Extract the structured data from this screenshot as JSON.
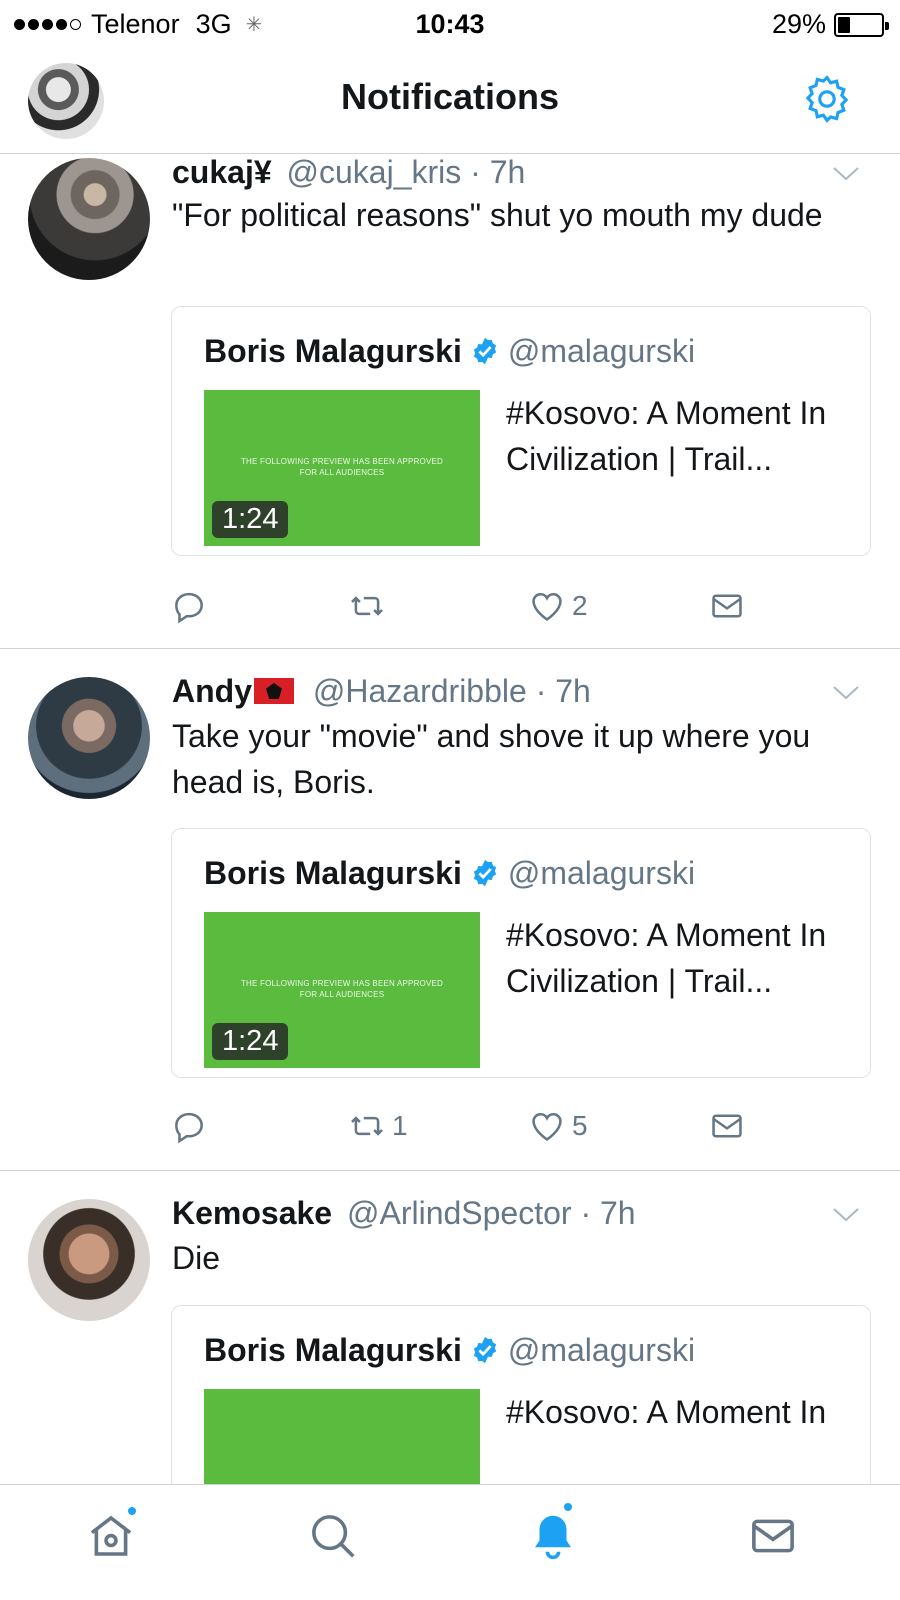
{
  "status_bar": {
    "carrier": "Telenor",
    "network": "3G",
    "time": "10:43",
    "battery": "29%",
    "battery_level": 0.29
  },
  "nav": {
    "title": "Notifications",
    "accent_color": "#1da1f2"
  },
  "tweets": [
    {
      "name": "cukaj¥",
      "handle": "@cukaj_kris",
      "time": "· 7h",
      "text": "\"For political reasons\" shut yo mouth my dude",
      "quoted": {
        "name": "Boris Malagurski",
        "handle": "@malagurski",
        "title": "#Kosovo: A Moment In Civilization | Trail...",
        "duration": "1:24",
        "thumb_text": "THE FOLLOWING PREVIEW HAS BEEN APPROVED FOR ALL AUDIENCES"
      },
      "retweets": "",
      "likes": "2"
    },
    {
      "name": "Andy",
      "flag": "🇦🇱",
      "handle": "@Hazardribble",
      "time": "· 7h",
      "text": "Take your \"movie\" and shove it up where you head is, Boris.",
      "quoted": {
        "name": "Boris Malagurski",
        "handle": "@malagurski",
        "title": "#Kosovo: A Moment In Civilization | Trail...",
        "duration": "1:24",
        "thumb_text": "THE FOLLOWING PREVIEW HAS BEEN APPROVED FOR ALL AUDIENCES"
      },
      "retweets": "1",
      "likes": "5"
    },
    {
      "name": "Kemosake",
      "handle": "@ArlindSpector",
      "time": "· 7h",
      "text": "Die",
      "quoted": {
        "name": "Boris Malagurski",
        "handle": "@malagurski",
        "title": "#Kosovo: A Moment In",
        "duration": "",
        "thumb_text": ""
      }
    }
  ],
  "tab_bar": {
    "items": [
      "home-icon",
      "search-icon",
      "notifications-bell-icon",
      "messages-icon"
    ],
    "active": "notifications"
  }
}
